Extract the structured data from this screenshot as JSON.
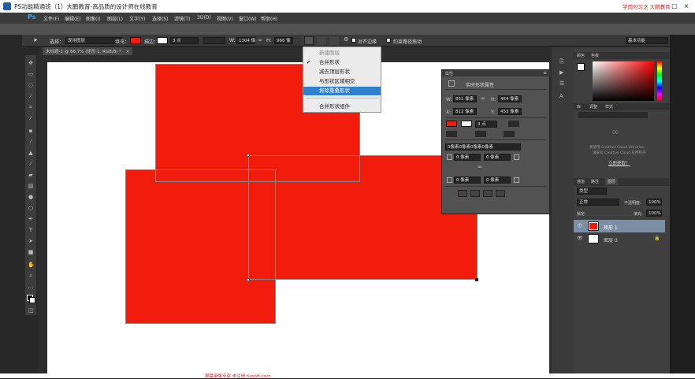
{
  "window": {
    "title": "PS功能精通班（1）大鹏教育-高品质的设计师在线教育",
    "watermark": "学而时习之 大鹏教育"
  },
  "menubar": [
    "文件(F)",
    "编辑(E)",
    "图像(I)",
    "图层(L)",
    "文字(Y)",
    "选择(S)",
    "滤镜(T)",
    "3D(D)",
    "视图(V)",
    "窗口(W)",
    "帮助(H)"
  ],
  "options": {
    "select_label": "选择：",
    "select_value": "现用图层",
    "fill_label": "填充：",
    "stroke_label": "描边：",
    "stroke_size": "3 点",
    "w_label": "W:",
    "w_value": "1304 像",
    "h_label": "H:",
    "h_value": "966 像",
    "align_edges": "对齐边缘",
    "constrain_path": "约束路径拖动",
    "workspace": "基本功能"
  },
  "doctab": {
    "title": "未标题-1 @ 66.7% (矩形 1, RGB/8) *",
    "close": "×"
  },
  "dropdown": {
    "items": [
      "新建图层",
      "合并形状",
      "减去顶层形状",
      "与形状区域相交",
      "排除重叠形状",
      "合并形状组件"
    ],
    "checked_index": 1,
    "selected_index": 4,
    "disabled_index": 0
  },
  "properties": {
    "header": "属性",
    "title": "实时形状属性",
    "w_label": "W:",
    "w_value": "851 像素",
    "h_label": "H:",
    "h_value": "464 像素",
    "x_label": "X:",
    "x_value": "812 像素",
    "y_label": "Y:",
    "y_value": "453 像素",
    "stroke_size": "3 点",
    "corner_all": "0像素0像素0像素0像素",
    "corner_tl": "0 像素",
    "corner_tr": "0 像素",
    "corner_bl": "0 像素",
    "corner_br": "0 像素"
  },
  "colorpanel": {
    "tab1": "颜色",
    "tab2": "色板"
  },
  "librariespanel": {
    "tab1": "库",
    "tab2": "调整",
    "tab3": "样式",
    "msg1": "要使用 Creative Cloud Libraries，",
    "msg2": "请安装 Creative Cloud 应用程序",
    "link": "立即获取！"
  },
  "layerspanel": {
    "tab1": "通道",
    "tab2": "路径",
    "tab3": "图层",
    "kind_label": "类型",
    "blend_mode": "正常",
    "opacity_label": "不透明度:",
    "opacity_value": "100%",
    "lock_label": "锁定:",
    "fill_label": "填充:",
    "fill_value": "100%",
    "layers": [
      {
        "name": "矩形 1",
        "selected": true
      },
      {
        "name": "图层 0",
        "selected": false
      }
    ]
  },
  "footer": {
    "watermark": "屏幕录像专家 未注册 tlxsoft.com"
  },
  "colors": {
    "accent_red": "#f11c0c",
    "ps_blue": "#31a8ff",
    "selection": "#2f80ce"
  }
}
